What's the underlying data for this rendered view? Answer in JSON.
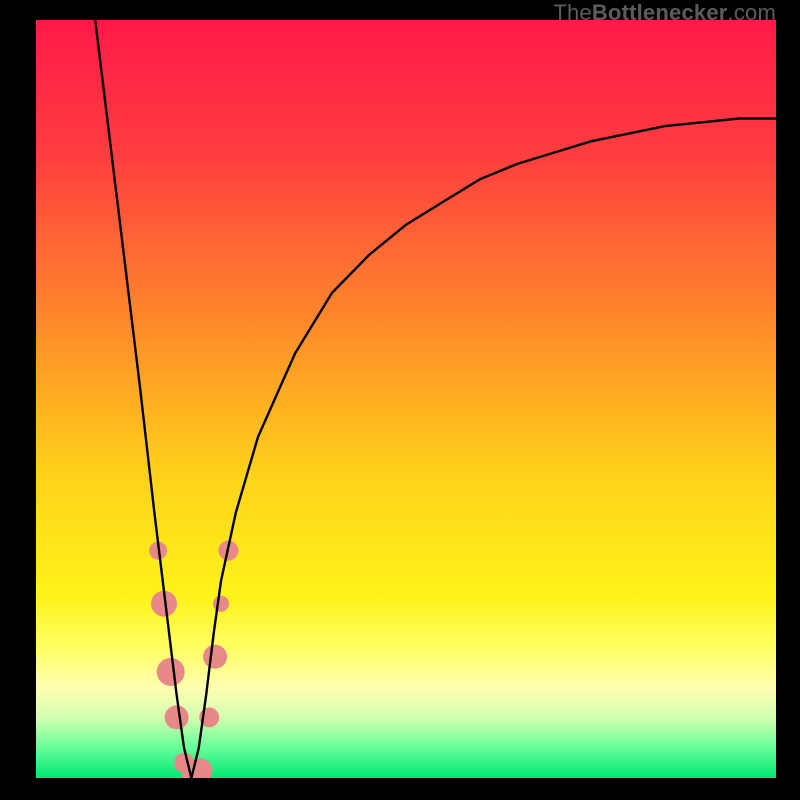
{
  "watermark": {
    "prefix": "The",
    "bold": "Bottlenecker",
    "suffix": ".com"
  },
  "chart_data": {
    "type": "line",
    "title": "",
    "xlabel": "",
    "ylabel": "",
    "xlim": [
      0,
      100
    ],
    "ylim": [
      0,
      100
    ],
    "x_optimum": 21,
    "gradient_stops": [
      {
        "offset": 0,
        "color": "#ff1a49"
      },
      {
        "offset": 18,
        "color": "#ff3e3f"
      },
      {
        "offset": 40,
        "color": "#ff8a2a"
      },
      {
        "offset": 60,
        "color": "#ffd21a"
      },
      {
        "offset": 76,
        "color": "#fff31a"
      },
      {
        "offset": 83,
        "color": "#ffff66"
      },
      {
        "offset": 88,
        "color": "#ffffb0"
      },
      {
        "offset": 92,
        "color": "#d3ffb0"
      },
      {
        "offset": 96,
        "color": "#66ff99"
      },
      {
        "offset": 100,
        "color": "#00e673"
      }
    ],
    "series": [
      {
        "name": "bottleneck-curve",
        "x": [
          8,
          10,
          12,
          14,
          16,
          17,
          18,
          19,
          20,
          21,
          22,
          23,
          24,
          25,
          27,
          30,
          35,
          40,
          45,
          50,
          55,
          60,
          65,
          70,
          75,
          80,
          85,
          90,
          95,
          100
        ],
        "y": [
          100,
          84,
          68,
          52,
          35,
          27,
          19,
          11,
          4,
          0,
          4,
          11,
          19,
          26,
          35,
          45,
          56,
          64,
          69,
          73,
          76,
          79,
          81,
          82.5,
          84,
          85,
          86,
          86.5,
          87,
          87
        ]
      }
    ],
    "markers": {
      "name": "sample-points",
      "color": "#e98888",
      "points": [
        {
          "x": 16.5,
          "y": 30,
          "r": 9
        },
        {
          "x": 17.3,
          "y": 23,
          "r": 13
        },
        {
          "x": 18.2,
          "y": 14,
          "r": 14
        },
        {
          "x": 19.0,
          "y": 8,
          "r": 12
        },
        {
          "x": 20.0,
          "y": 2,
          "r": 10
        },
        {
          "x": 21.0,
          "y": 0,
          "r": 10
        },
        {
          "x": 22.2,
          "y": 1,
          "r": 12
        },
        {
          "x": 23.4,
          "y": 8,
          "r": 10
        },
        {
          "x": 24.2,
          "y": 16,
          "r": 12
        },
        {
          "x": 25.0,
          "y": 23,
          "r": 8
        },
        {
          "x": 26.0,
          "y": 30,
          "r": 10
        }
      ]
    }
  }
}
